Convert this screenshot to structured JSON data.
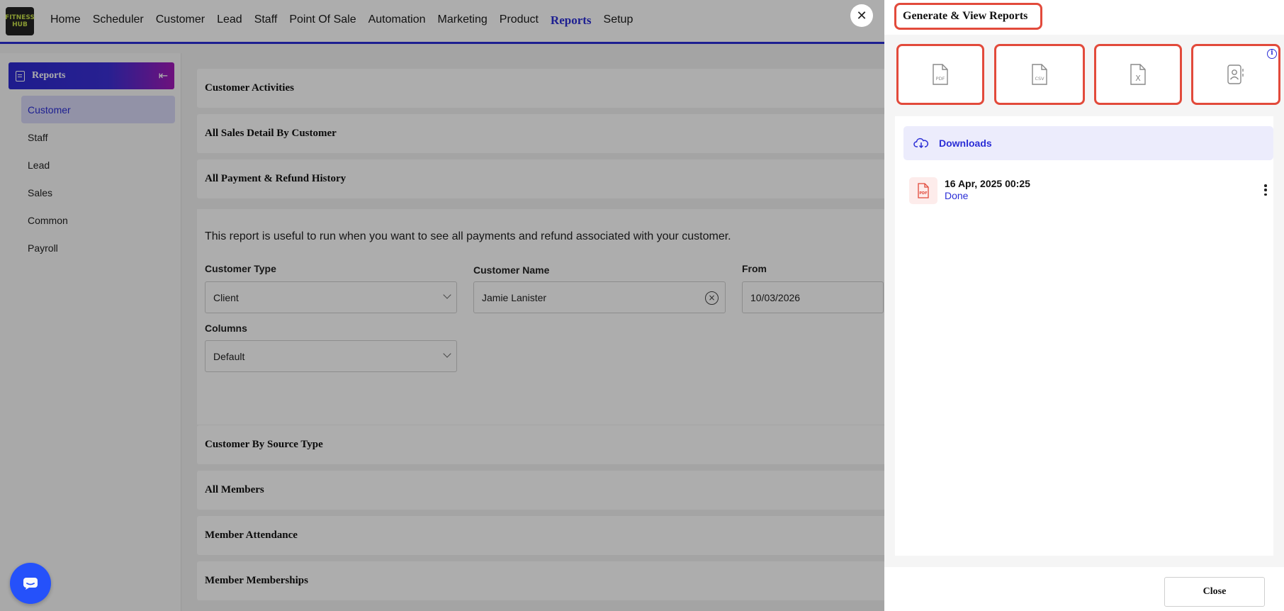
{
  "app": {
    "logo_text_top": "FITNESS",
    "logo_text_bottom": "HUB"
  },
  "nav": {
    "items": [
      "Home",
      "Scheduler",
      "Customer",
      "Lead",
      "Staff",
      "Point Of Sale",
      "Automation",
      "Marketing",
      "Product",
      "Reports",
      "Setup"
    ],
    "active": "Reports"
  },
  "sidebar": {
    "title": "Reports",
    "items": [
      "Customer",
      "Staff",
      "Lead",
      "Sales",
      "Common",
      "Payroll"
    ],
    "active": "Customer"
  },
  "main": {
    "sections_above": [
      "Customer Activities",
      "All Sales Detail By Customer",
      "All Payment & Refund History"
    ],
    "open_section": {
      "description": "This report is useful to run when you want to see all payments and refund associated with your customer.",
      "customer_type_label": "Customer Type",
      "customer_type_value": "Client",
      "customer_name_label": "Customer Name",
      "customer_name_value": "Jamie Lanister",
      "from_label": "From",
      "from_value": "10/03/2026",
      "columns_label": "Columns",
      "columns_value": "Default"
    },
    "sections_below": [
      "Customer By Source Type",
      "All Members",
      "Member Attendance",
      "Member Memberships"
    ]
  },
  "drawer": {
    "title": "Generate & View Reports",
    "export_buttons": [
      {
        "icon": "pdf-file-icon",
        "tag": "PDF"
      },
      {
        "icon": "csv-file-icon",
        "tag": "CSV"
      },
      {
        "icon": "excel-file-icon",
        "tag": "X"
      },
      {
        "icon": "contact-file-icon",
        "tag": ""
      }
    ],
    "downloads_label": "Downloads",
    "downloads": [
      {
        "date": "16 Apr, 2025 00:25",
        "status": "Done",
        "type": "PDF"
      }
    ],
    "close_label": "Close"
  },
  "colors": {
    "accent": "#2b2ed6",
    "highlight_border": "#e24a3b",
    "chat": "#1e4dff"
  }
}
